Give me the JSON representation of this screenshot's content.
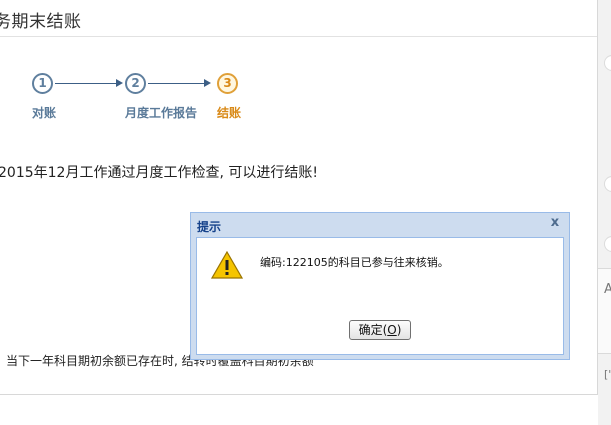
{
  "page": {
    "title": "务期末结账"
  },
  "steps": [
    {
      "number": "1",
      "label": "对账",
      "active": false
    },
    {
      "number": "2",
      "label": "月度工作报告",
      "active": false
    },
    {
      "number": "3",
      "label": "结账",
      "active": true
    }
  ],
  "message": "2015年12月工作通过月度工作检查, 可以进行结账!",
  "note": "当下一年科目期初余额已存在时, 结转时覆盖科目期初余额",
  "dialog": {
    "title": "提示",
    "close_label": "x",
    "text": "编码:122105的科目已参与往来核销。",
    "ok_label": "确定(O)",
    "ok_prefix": "确定(",
    "ok_mnemonic": "O",
    "ok_suffix": ")"
  },
  "right_strip": {
    "letter_a": "A",
    "letter_b": "['"
  },
  "colors": {
    "step_inactive": "#5f7f9e",
    "step_active": "#e0a038",
    "dialog_frame": "#cddcef",
    "dialog_title": "#15428b"
  },
  "icons": {
    "warning": "warning-triangle-icon",
    "close": "close-icon"
  }
}
